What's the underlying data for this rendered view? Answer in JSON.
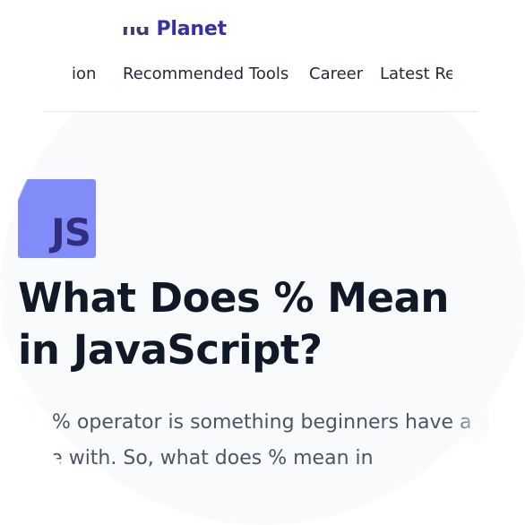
{
  "header": {
    "brand_prefix": "nd",
    "brand_name": "Planet",
    "nav": [
      {
        "label": "ion"
      },
      {
        "label": "Recommended Tools"
      },
      {
        "label": "Career"
      },
      {
        "label": "Latest Re"
      }
    ]
  },
  "article": {
    "logo_text": "JS",
    "title": "What Does % Mean in JavaScript?",
    "excerpt": "% operator is something beginners have a time with. So, what does % mean in"
  },
  "colors": {
    "brand": "#3730a3",
    "logo_bg": "#818cf8",
    "logo_text": "#312e81",
    "title": "#111827",
    "body_text": "#4b5563"
  }
}
